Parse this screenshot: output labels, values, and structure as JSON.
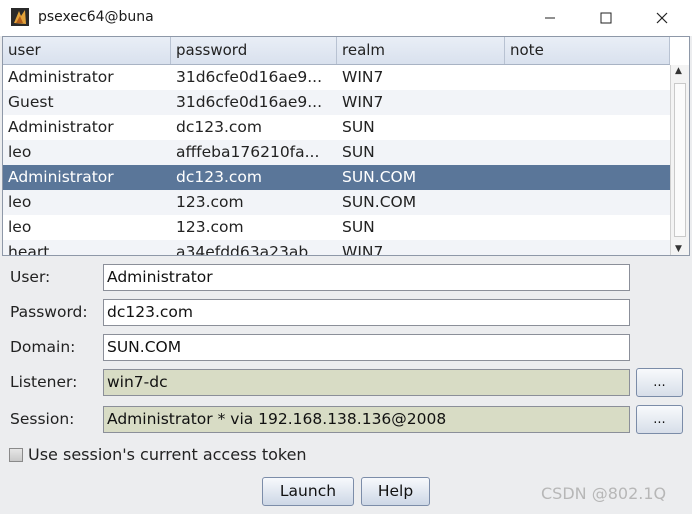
{
  "window": {
    "title": "psexec64@buna"
  },
  "table": {
    "columns": [
      "user",
      "password",
      "realm",
      "note"
    ],
    "rows": [
      [
        "Administrator",
        "31d6cfe0d16ae9...",
        "WIN7",
        ""
      ],
      [
        "Guest",
        "31d6cfe0d16ae9...",
        "WIN7",
        ""
      ],
      [
        "Administrator",
        "dc123.com",
        "SUN",
        ""
      ],
      [
        "leo",
        "afffeba176210fa...",
        "SUN",
        ""
      ],
      [
        "Administrator",
        "dc123.com",
        "SUN.COM",
        ""
      ],
      [
        "leo",
        "123.com",
        "SUN.COM",
        ""
      ],
      [
        "leo",
        "123.com",
        "SUN",
        ""
      ],
      [
        "heart",
        "a34efdd63a23ab...",
        "WIN7",
        ""
      ]
    ],
    "selected_index": 4
  },
  "form": {
    "user_label": "User:",
    "user_value": "Administrator",
    "password_label": "Password:",
    "password_value": "dc123.com",
    "domain_label": "Domain:",
    "domain_value": "SUN.COM",
    "listener_label": "Listener:",
    "listener_value": "win7-dc",
    "session_label": "Session:",
    "session_value": "Administrator * via  192.168.138.136@2008",
    "browse_label": "...",
    "checkbox_label": "Use session's current access token"
  },
  "buttons": {
    "launch": "Launch",
    "help": "Help"
  },
  "watermark": "CSDN @802.1Q",
  "icons": {
    "app": "app-logo-icon",
    "minimize": "minimize-icon",
    "maximize": "maximize-icon",
    "close": "close-icon",
    "scroll_up": "scroll-up-icon",
    "scroll_down": "scroll-down-icon"
  },
  "colors": {
    "selection": "#5a7699",
    "readonly_field": "#d8dcc5"
  }
}
